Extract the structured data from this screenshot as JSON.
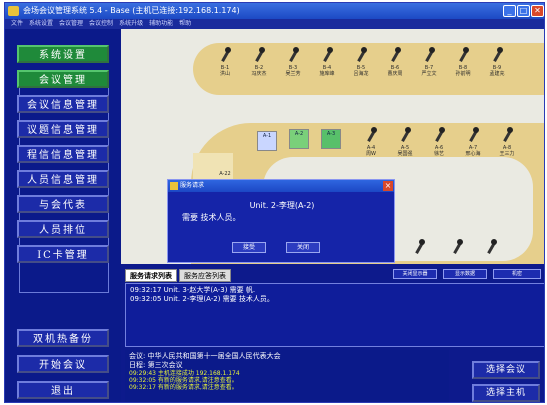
{
  "window": {
    "title": "会场会议管理系统 5.4 - Base (主机已连接:192.168.1.174)",
    "controls": {
      "minimize": "_",
      "maximize": "□",
      "close": "✕"
    }
  },
  "menubar": {
    "items": [
      "文件",
      "系统设置",
      "会议管理",
      "会议控制",
      "系统升级",
      "辅助功能",
      "帮助"
    ]
  },
  "sidebar": {
    "items": [
      {
        "label": "系统设置",
        "style": "green"
      },
      {
        "label": "会议管理",
        "style": "green"
      },
      {
        "label": "会议信息管理",
        "style": "blue"
      },
      {
        "label": "议题信息管理",
        "style": "blue"
      },
      {
        "label": "程信信息管理",
        "style": "blue"
      },
      {
        "label": "人员信息管理",
        "style": "blue"
      },
      {
        "label": "与会代表",
        "style": "blue"
      },
      {
        "label": "人员排位",
        "style": "blue"
      },
      {
        "label": "IC卡管理",
        "style": "blue"
      }
    ],
    "bottom_items": [
      "双机热备份",
      "开始会议",
      "退出"
    ]
  },
  "seatmap": {
    "top_row": [
      {
        "id": "B-1",
        "name": "洪山"
      },
      {
        "id": "B-2",
        "name": "冯庆杰"
      },
      {
        "id": "B-3",
        "name": "吴兰芳"
      },
      {
        "id": "B-4",
        "name": "施库峰"
      },
      {
        "id": "B-5",
        "name": "吕海龙"
      },
      {
        "id": "B-6",
        "name": "曹庆周"
      },
      {
        "id": "B-7",
        "name": "严立文"
      },
      {
        "id": "B-8",
        "name": "孙前明"
      },
      {
        "id": "B-9",
        "name": "孟建充"
      }
    ],
    "mid_row": [
      {
        "id": "A-4",
        "name": "周W"
      },
      {
        "id": "A-5",
        "name": "吴国强"
      },
      {
        "id": "A-6",
        "name": "徐艺"
      },
      {
        "id": "A-7",
        "name": "邢心海"
      },
      {
        "id": "A-8",
        "name": "王三力"
      }
    ],
    "icons": [
      {
        "label": "A-1",
        "style": "c1"
      },
      {
        "label": "A-2",
        "style": "c2"
      },
      {
        "label": "A-3",
        "style": "c3"
      }
    ],
    "left_seat": "A-22"
  },
  "dialog": {
    "title": "服务请求",
    "line1": "Unit. 2-李理(A-2)",
    "line2": "需要 技术人员。",
    "ok": "接受",
    "cancel": "关闭"
  },
  "toolbar": {
    "btn1": "关闭显示器",
    "btn2": "显示数据",
    "btn3": "机密"
  },
  "tabs": {
    "tab1": "服务请求列表",
    "tab2": "服务应答列表"
  },
  "log": {
    "lines": [
      "09:32:17  Unit. 3-赵大学(A-3) 需要 帆.",
      "09:32:05  Unit. 2-李理(A-2) 需要 技术人员。"
    ]
  },
  "info": {
    "meeting": "会议:  中华人民共和国第十一届全国人民代表大会",
    "agenda": "日程:  第三次会议",
    "status": [
      "09:29:43 主机连接成功 192.168.1.174",
      "09:32:05 有新的服务请求,请注意查看。",
      "09:32:17 有新的服务请求,请注意查看。"
    ]
  },
  "right_buttons": {
    "select_meeting": "选择会议",
    "select_host": "选择主机"
  }
}
